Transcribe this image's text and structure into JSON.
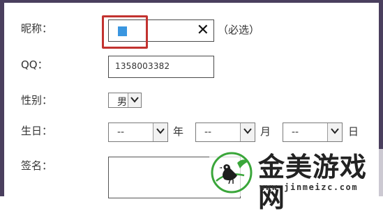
{
  "form": {
    "nickname": {
      "label": "昵称：",
      "clear_icon": "close-icon",
      "required_text": "（必选）",
      "value": ""
    },
    "qq": {
      "label": "QQ：",
      "value": "1358003382"
    },
    "gender": {
      "label": "性别：",
      "selected": "男"
    },
    "birthday": {
      "label": "生日：",
      "year": {
        "selected": "--",
        "unit": "年"
      },
      "month": {
        "selected": "--",
        "unit": "月"
      },
      "day": {
        "selected": "--",
        "unit": "日"
      }
    },
    "signature": {
      "label": "签名：",
      "value": ""
    }
  },
  "watermark": {
    "title": "金美游戏网",
    "url": "www.jinmeizc.com",
    "icon": "bird-logo-icon"
  },
  "colors": {
    "highlight_border": "#c2322f",
    "caret_blue": "#3a96e0",
    "frame": "#4a3f5e"
  }
}
